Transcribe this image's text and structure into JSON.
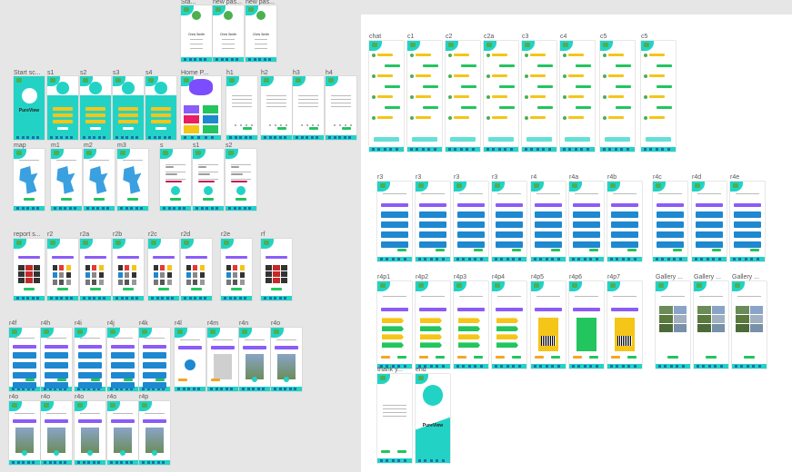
{
  "canvas": {
    "bg": "#e6e6e6",
    "board_bg": "#ffffff",
    "accent": "#22d3c5",
    "button_green": "#22c55e",
    "button_blue": "#1e88d0",
    "purple": "#8b5cf6",
    "yellow": "#f5c518"
  },
  "left_board": {
    "row0": [
      "Sta...",
      "new pas...",
      "new pas..."
    ],
    "row1": [
      "Start sc...",
      "s1",
      "s2",
      "s3",
      "s4",
      "Home P...",
      "h1",
      "h2",
      "h3",
      "h4"
    ],
    "row2": [
      "map",
      "m1",
      "m2",
      "m3",
      "s",
      "s1",
      "s2"
    ],
    "row3": [
      "report s...",
      "r2",
      "r2a",
      "r2b",
      "r2c",
      "r2d",
      "r2e",
      "rf"
    ],
    "row4": [
      "r4f",
      "r4h",
      "r4i",
      "r4j",
      "r4k",
      "r4l",
      "r4m",
      "r4n",
      "r4o"
    ],
    "row5": [
      "r4o",
      "r4o",
      "r4o",
      "r4o",
      "r4p"
    ]
  },
  "right_board": {
    "row1": [
      "chat",
      "c1",
      "c2",
      "c2a",
      "c3",
      "c4",
      "c5",
      "c5"
    ],
    "row2": [
      "r3",
      "r3",
      "r3",
      "r3",
      "r4",
      "r4a",
      "r4b",
      "r4c",
      "r4d",
      "r4e"
    ],
    "row3": [
      "r4p1",
      "r4p2",
      "r4p3",
      "r4p4",
      "r4p5",
      "r4p6",
      "r4p7",
      "Gallery ...",
      "Gallery ...",
      "Gallery ..."
    ],
    "row4": [
      "thank y...",
      "end"
    ]
  },
  "screen_text": {
    "brand": "PureView",
    "user_name": "Chris Smith",
    "chat_title": "chat",
    "reports_title": "Overview reflections",
    "lunch_title": "Lunch/hike",
    "collect_title": "Collect Your Rewards",
    "gallery_title": "Gallery",
    "thank_you": "Thank you for your details"
  }
}
